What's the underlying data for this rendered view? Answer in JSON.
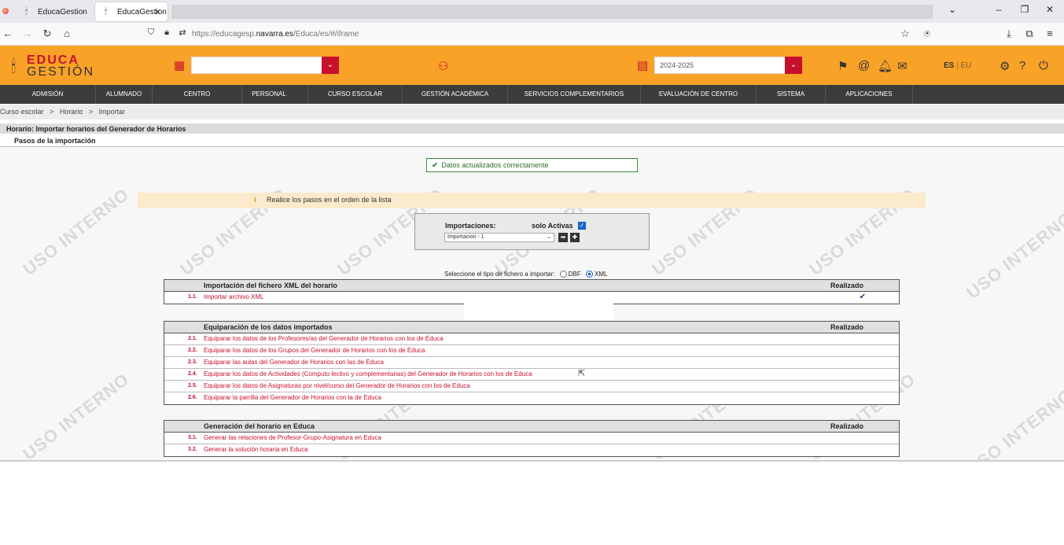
{
  "browser": {
    "tabs": [
      {
        "label": "EducaGestion",
        "active": false
      },
      {
        "label": "EducaGestion",
        "active": true
      }
    ],
    "url_prefix": "https://educagesp.",
    "url_domain": "navarra.es",
    "url_path": "/Educa/es/#/iframe"
  },
  "header": {
    "logo_top": "EDUCA",
    "logo_bottom": "GESTIÓN",
    "center_select_value": "",
    "year_select_value": "2024-2025",
    "lang_es": "ES",
    "lang_sep": "|",
    "lang_eu": "EU",
    "colors": {
      "primary": "#f9a228",
      "accent": "#c8102e"
    }
  },
  "menu": [
    "ADMISIÓN",
    "ALUMNADO",
    "CENTRO",
    "PERSONAL",
    "CURSO ESCOLAR",
    "GESTIÓN ACADÉMICA",
    "SERVICIOS COMPLEMENTARIOS",
    "EVALUACIÓN DE CENTRO",
    "SISTEMA",
    "APLICACIONES"
  ],
  "breadcrumb": {
    "items": [
      "Curso escolar",
      "Horario",
      "Importar"
    ],
    "sep": ">"
  },
  "page": {
    "title": "Horario: Importar horarios del Generador de Horarios",
    "subtitle": "Pasos de la importación",
    "success_msg": "Datos actualizados correctamente",
    "notice": "Realice los pasos en el orden de la lista",
    "watermark": "USO INTERNO"
  },
  "importaciones": {
    "label": "Importaciones:",
    "only_active_label": "solo Activas",
    "only_active_checked": true,
    "selected": "Importacion - 1"
  },
  "filetype": {
    "label": "Seleccione el tipo de fichero a importar:",
    "options": [
      "DBF",
      "XML"
    ],
    "selected": "XML"
  },
  "sections": [
    {
      "title": "Importación del fichero XML del horario",
      "done_label": "Realizado",
      "steps": [
        {
          "num": "1.1.",
          "label": "Importar archivo XML",
          "done": true
        }
      ]
    },
    {
      "title": "Equiparación de los datos importados",
      "done_label": "Realizado",
      "steps": [
        {
          "num": "2.1.",
          "label": "Equiparar los datos de los Profesores/as del Generador de Horarios con los de Educa",
          "done": false
        },
        {
          "num": "2.2.",
          "label": "Equiparar los datos de los Grupos del Generador de Horarios con los de Educa",
          "done": false
        },
        {
          "num": "2.3.",
          "label": "Equiparar las aulas del Generador de Horarios con las de Educa",
          "done": false
        },
        {
          "num": "2.4.",
          "label": "Equiparar los datos de Actividades (Computo lectivo y complementarias) del Generador de Horarios  con los de Educa",
          "done": false
        },
        {
          "num": "2.5.",
          "label": "Equiparar los datos de Asignaturas por nivel/curso del Generador de Horarios con los de Educa",
          "done": false
        },
        {
          "num": "2.6.",
          "label": "Equiparar la parrilla del Generador de Horarios con la de Educa",
          "done": false
        }
      ]
    },
    {
      "title": "Generación del horario en Educa",
      "done_label": "Realizado",
      "steps": [
        {
          "num": "3.1.",
          "label": "Generar las relaciones de Profesor-Grupo-Asignatura en Educa",
          "done": false
        },
        {
          "num": "3.2.",
          "label": "Generar la solución horaria en Educa",
          "done": false
        }
      ]
    }
  ]
}
